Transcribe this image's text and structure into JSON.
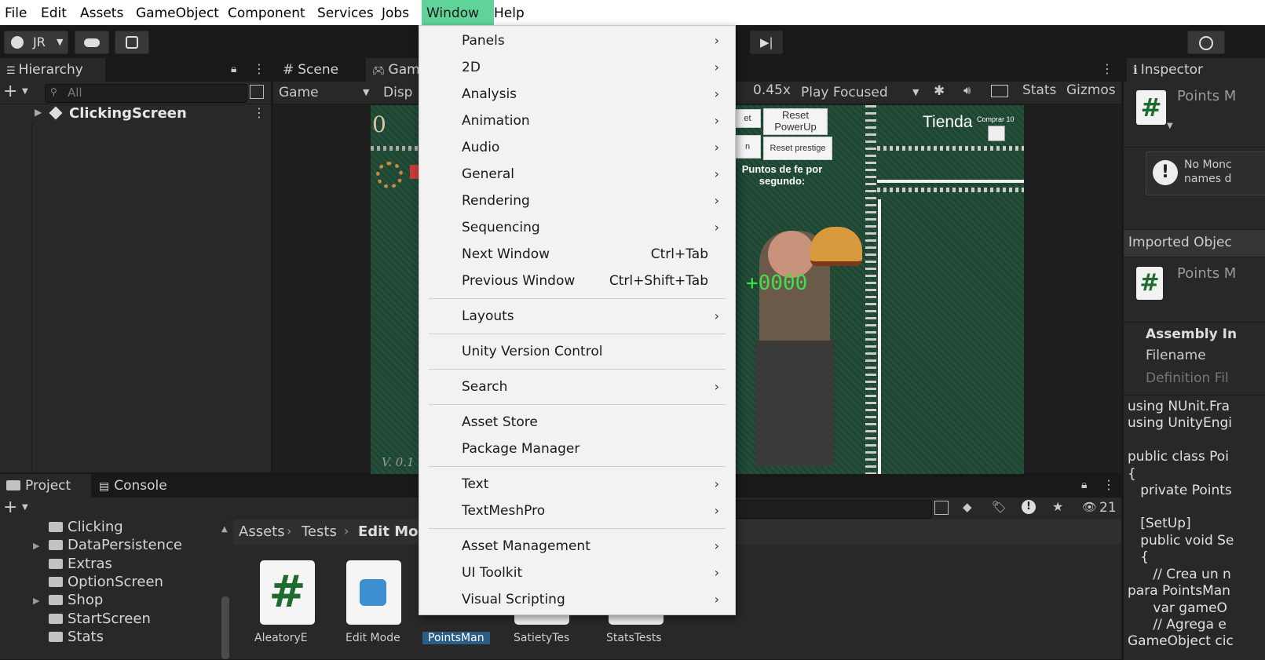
{
  "menubar": {
    "items": [
      "File",
      "Edit",
      "Assets",
      "GameObject",
      "Component",
      "Services",
      "Jobs",
      "Window",
      "Help"
    ],
    "active": "Window"
  },
  "toolbar": {
    "account": "JR"
  },
  "hierarchy": {
    "tab": "Hierarchy",
    "search_placeholder": "All",
    "root": "ClickingScreen"
  },
  "scene_tabs": {
    "scene": "Scene",
    "game": "Gam",
    "game_dropdown": "Game",
    "display": "Disp",
    "scale": "0.45x",
    "play_mode": "Play Focused",
    "stats": "Stats",
    "gizmos": "Gizmos"
  },
  "game": {
    "score": "0",
    "reset_powerup": "Reset PowerUp",
    "reset_prestige": "Reset prestige",
    "btn_partial_1": "et",
    "btn_partial_2": "n",
    "faith_label": "Puntos de fe por segundo:",
    "shop_title": "Tienda",
    "buy_10": "Comprar 10",
    "counter": "+0000",
    "version": "V. 0.1"
  },
  "window_menu": {
    "items": [
      {
        "label": "Panels",
        "submenu": true
      },
      {
        "label": "2D",
        "submenu": true
      },
      {
        "label": "Analysis",
        "submenu": true
      },
      {
        "label": "Animation",
        "submenu": true
      },
      {
        "label": "Audio",
        "submenu": true
      },
      {
        "label": "General",
        "submenu": true
      },
      {
        "label": "Rendering",
        "submenu": true
      },
      {
        "label": "Sequencing",
        "submenu": true
      },
      {
        "label": "Next Window",
        "shortcut": "Ctrl+Tab"
      },
      {
        "label": "Previous Window",
        "shortcut": "Ctrl+Shift+Tab"
      },
      {
        "label": "Layouts",
        "submenu": true
      },
      {
        "label": "Unity Version Control"
      },
      {
        "label": "Search",
        "submenu": true
      },
      {
        "label": "Asset Store"
      },
      {
        "label": "Package Manager"
      },
      {
        "label": "Text",
        "submenu": true
      },
      {
        "label": "TextMeshPro",
        "submenu": true
      },
      {
        "label": "Asset Management",
        "submenu": true
      },
      {
        "label": "UI Toolkit",
        "submenu": true
      },
      {
        "label": "Visual Scripting",
        "submenu": true
      }
    ]
  },
  "inspector": {
    "tab": "Inspector",
    "title": "Points M",
    "warning_line1": "No Monc",
    "warning_line2": "names d",
    "imported": "Imported Objec",
    "title2": "Points M",
    "assembly": "Assembly In",
    "filename": "Filename",
    "definition": "Definition Fil",
    "code": [
      "using NUnit.Fra",
      "using UnityEngi",
      "",
      "public class Poi",
      "{",
      "   private Points",
      "",
      "   [SetUp]",
      "   public void Se",
      "   {",
      "      // Crea un n",
      "para PointsMan",
      "      var gameO",
      "      // Agrega e",
      "GameObject cic"
    ]
  },
  "project": {
    "tab_project": "Project",
    "tab_console": "Console",
    "folders": [
      {
        "name": "Clicking",
        "expandable": false
      },
      {
        "name": "DataPersistence",
        "expandable": true
      },
      {
        "name": "Extras",
        "expandable": false
      },
      {
        "name": "OptionScreen",
        "expandable": false
      },
      {
        "name": "Shop",
        "expandable": true
      },
      {
        "name": "StartScreen",
        "expandable": false
      },
      {
        "name": "Stats",
        "expandable": false
      }
    ],
    "breadcrumb": [
      "Assets",
      "Tests",
      "Edit Mod"
    ],
    "hidden_count": "21",
    "assets": [
      "AleatoryE",
      "Edit Mode",
      "PointsMan",
      "SatietyTes",
      "StatsTests"
    ]
  },
  "colors": {
    "menu_highlight": "#5fd39a",
    "game_bg": "#1f4a35",
    "selected_asset": "#2c5d87"
  }
}
